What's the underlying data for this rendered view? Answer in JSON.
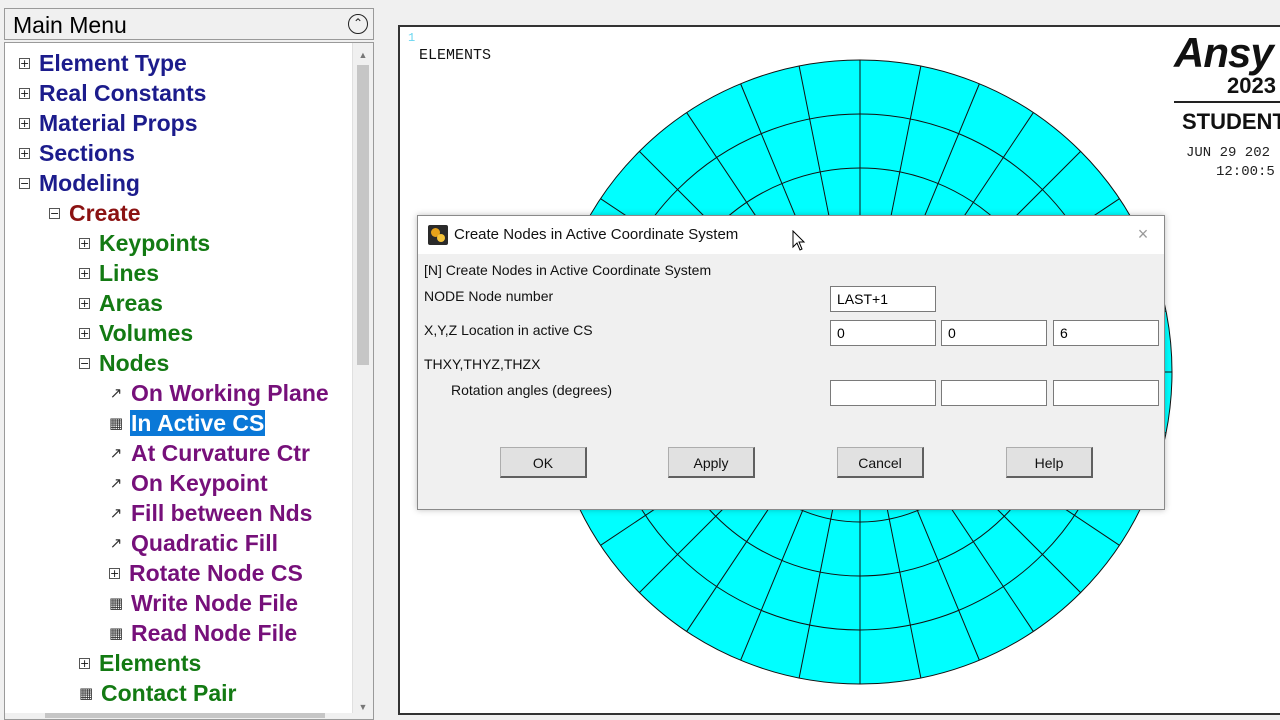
{
  "main_menu": {
    "title": "Main Menu",
    "collapse_glyph": "⌃",
    "collapse_icon": "double-chevron-up-icon",
    "items": [
      {
        "label": "Element Type",
        "marker": "⊞",
        "marker_icon": "expand-plus-icon",
        "color": "#1c1c8c"
      },
      {
        "label": "Real Constants",
        "marker": "⊞",
        "marker_icon": "expand-plus-icon",
        "color": "#1c1c8c"
      },
      {
        "label": "Material Props",
        "marker": "⊞",
        "marker_icon": "expand-plus-icon",
        "color": "#1c1c8c"
      },
      {
        "label": "Sections",
        "marker": "⊞",
        "marker_icon": "expand-plus-icon",
        "color": "#1c1c8c"
      },
      {
        "label": "Modeling",
        "marker": "⊟",
        "marker_icon": "collapse-minus-icon",
        "color": "#1c1c8c"
      },
      {
        "label": "Create",
        "marker": "⊟",
        "marker_icon": "collapse-minus-icon",
        "color": "#8b1212"
      },
      {
        "label": "Keypoints",
        "marker": "⊞",
        "marker_icon": "expand-plus-icon",
        "color": "#137a13"
      },
      {
        "label": "Lines",
        "marker": "⊞",
        "marker_icon": "expand-plus-icon",
        "color": "#137a13"
      },
      {
        "label": "Areas",
        "marker": "⊞",
        "marker_icon": "expand-plus-icon",
        "color": "#137a13"
      },
      {
        "label": "Volumes",
        "marker": "⊞",
        "marker_icon": "expand-plus-icon",
        "color": "#137a13"
      },
      {
        "label": "Nodes",
        "marker": "⊟",
        "marker_icon": "collapse-minus-icon",
        "color": "#137a13"
      },
      {
        "label": "On Working Plane",
        "marker": "↗",
        "marker_icon": "pick-arrow-icon",
        "color": "#76107a"
      },
      {
        "label": "In Active CS",
        "marker": "▦",
        "marker_icon": "dialog-icon",
        "color": "#76107a",
        "selected": true
      },
      {
        "label": "At Curvature Ctr",
        "marker": "↗",
        "marker_icon": "pick-arrow-icon",
        "color": "#76107a"
      },
      {
        "label": "On Keypoint",
        "marker": "↗",
        "marker_icon": "pick-arrow-icon",
        "color": "#76107a"
      },
      {
        "label": "Fill between Nds",
        "marker": "↗",
        "marker_icon": "pick-arrow-icon",
        "color": "#76107a"
      },
      {
        "label": "Quadratic Fill",
        "marker": "↗",
        "marker_icon": "pick-arrow-icon",
        "color": "#76107a"
      },
      {
        "label": "Rotate Node CS",
        "marker": "⊞",
        "marker_icon": "expand-plus-icon",
        "color": "#76107a"
      },
      {
        "label": "Write Node File",
        "marker": "▦",
        "marker_icon": "dialog-icon",
        "color": "#76107a"
      },
      {
        "label": "Read Node File",
        "marker": "▦",
        "marker_icon": "dialog-icon",
        "color": "#76107a"
      },
      {
        "label": "Elements",
        "marker": "⊞",
        "marker_icon": "expand-plus-icon",
        "color": "#137a13"
      },
      {
        "label": "Contact Pair",
        "marker": "▦",
        "marker_icon": "dialog-icon",
        "color": "#137a13"
      }
    ]
  },
  "graphics": {
    "window_number": "1",
    "plot_label": "ELEMENTS",
    "logo_brand": "Ansy",
    "logo_year": "2023",
    "logo_edition": "STUDENT",
    "date": "JUN 29 202",
    "time": "12:00:5",
    "mesh_color": "#00ffff"
  },
  "dialog": {
    "title": "Create Nodes in Active Coordinate System",
    "close_glyph": "×",
    "heading": "[N]  Create Nodes in Active Coordinate System",
    "node_label": "NODE   Node number",
    "node_value": "LAST+1",
    "xyz_label": "X,Y,Z  Location in active CS",
    "x_value": "0",
    "y_value": "0",
    "z_value": "6",
    "theta_label": "THXY,THYZ,THZX",
    "rotation_label": "Rotation angles (degrees)",
    "rot_x_value": "",
    "rot_y_value": "",
    "rot_z_value": "",
    "buttons": {
      "ok": "OK",
      "apply": "Apply",
      "cancel": "Cancel",
      "help": "Help"
    }
  }
}
